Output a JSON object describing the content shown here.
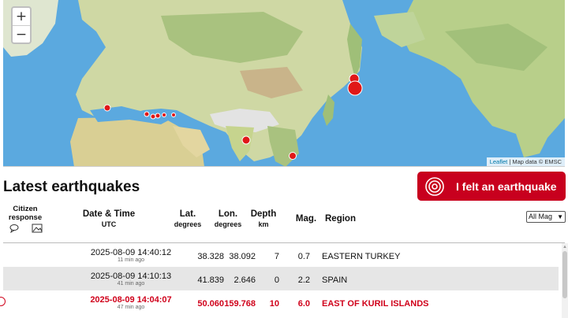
{
  "map": {
    "zoom_in": "+",
    "zoom_out": "−",
    "attribution_link": "Leaflet",
    "attribution_text": "| Map data © EMSC",
    "colors": {
      "ocean": "#5ba9df",
      "land": "#cfd8a4",
      "marker": "#e01818"
    }
  },
  "page": {
    "title": "Latest earthquakes",
    "felt_button": "I felt an earthquake",
    "felt_icon": "concentric-circles-icon"
  },
  "table": {
    "headers": {
      "citizen": "Citizen response",
      "datetime": "Date & Time",
      "datetime_sub": "UTC",
      "lat": "Lat.",
      "lat_sub": "degrees",
      "lon": "Lon.",
      "lon_sub": "degrees",
      "depth": "Depth",
      "depth_sub": "km",
      "mag": "Mag.",
      "region": "Region"
    },
    "mag_filter": "All Mag",
    "rows": [
      {
        "datetime": "2025-08-09 14:40:12",
        "ago": "11 min ago",
        "lat": "38.328",
        "lon": "38.092",
        "depth": "7",
        "mag": "0.7",
        "region": "EASTERN TURKEY"
      },
      {
        "datetime": "2025-08-09 14:10:13",
        "ago": "41 min ago",
        "lat": "41.839",
        "lon": "2.646",
        "depth": "0",
        "mag": "2.2",
        "region": "SPAIN"
      },
      {
        "datetime": "2025-08-09 14:04:07",
        "ago": "47 min ago",
        "lat": "50.060",
        "lon": "159.768",
        "depth": "10",
        "mag": "6.0",
        "region": "EAST OF KURIL ISLANDS"
      }
    ]
  }
}
